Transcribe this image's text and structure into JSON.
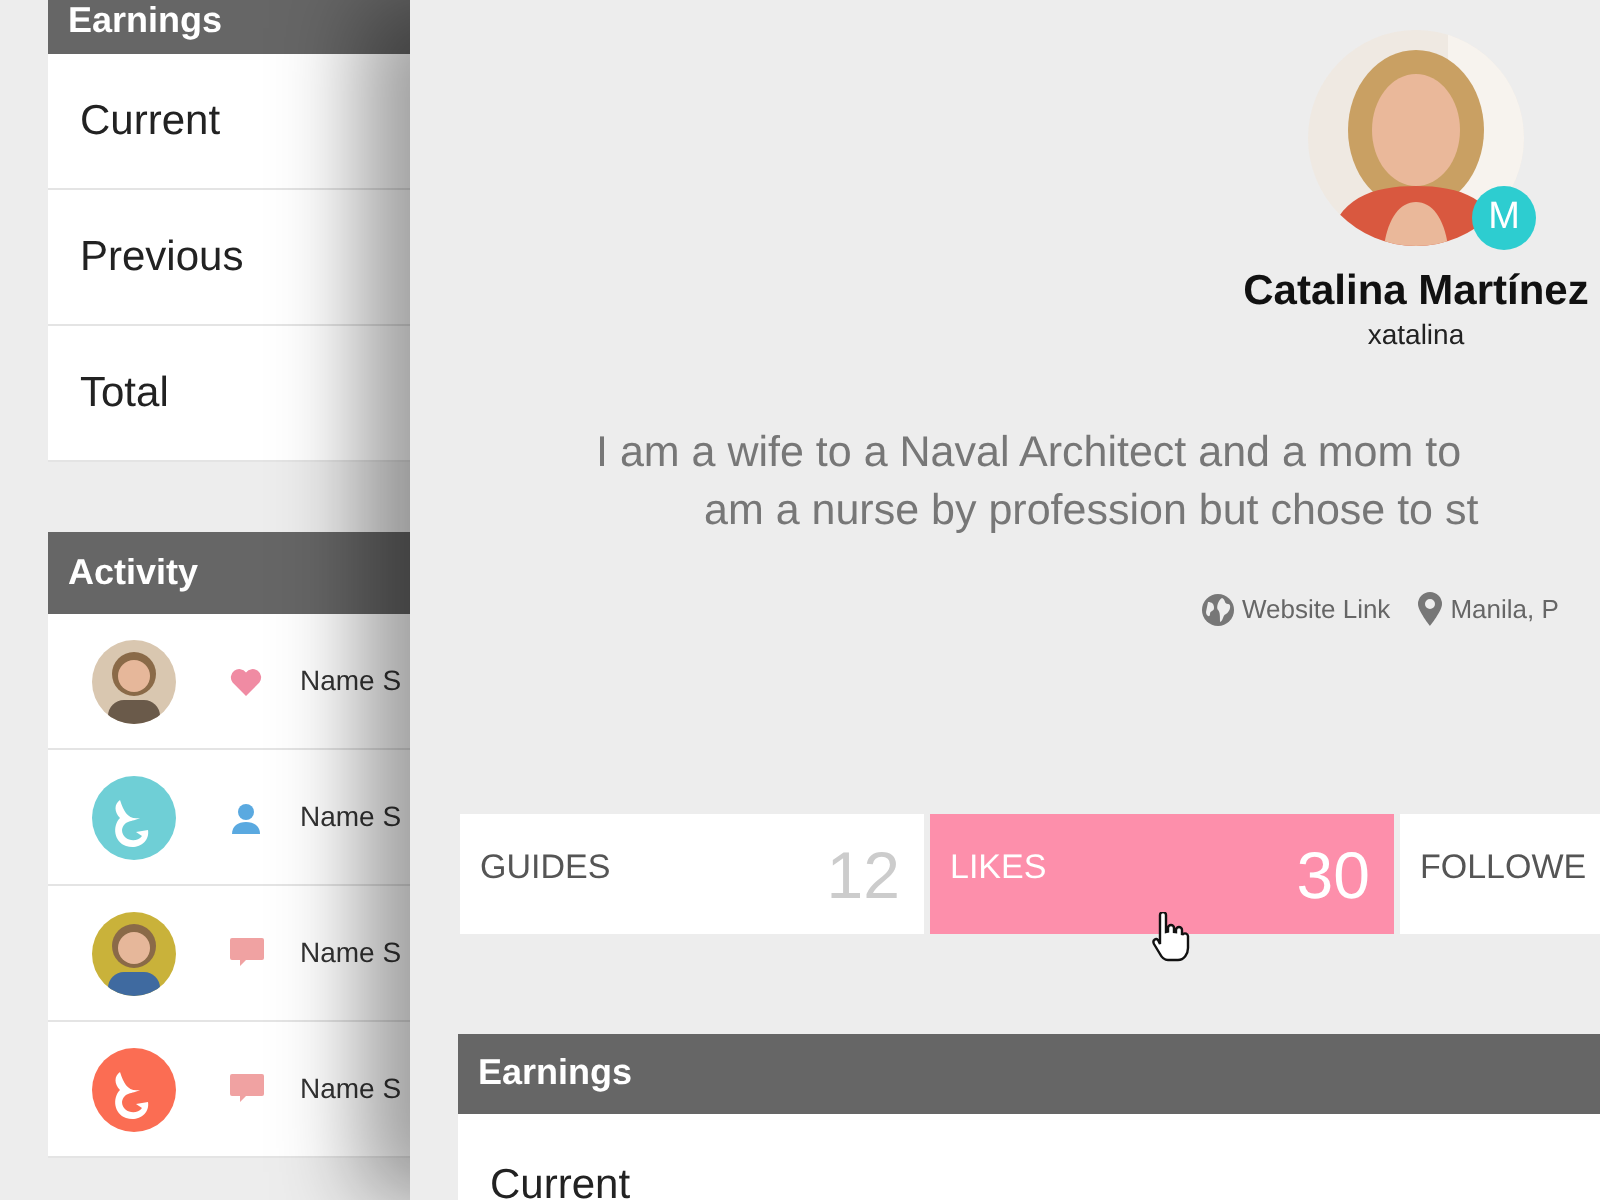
{
  "sidebar": {
    "earnings": {
      "title": "Earnings",
      "items": [
        "Current",
        "Previous",
        "Total"
      ]
    },
    "activity": {
      "title": "Activity",
      "rows": [
        {
          "kind": "like",
          "name": "Name S"
        },
        {
          "avatar": {
            "kind": "logo",
            "color": "#6fcfd6"
          },
          "kind": "follow",
          "name": "Name S"
        },
        {
          "kind": "comment",
          "name": "Name S"
        },
        {
          "avatar": {
            "kind": "logo",
            "color": "#fb6d53"
          },
          "kind": "comment",
          "name": "Name S"
        }
      ]
    }
  },
  "profile": {
    "badge": "M",
    "name": "Catalina Martínez",
    "username": "xatalina",
    "bio": [
      "I am a wife to a Naval Architect and a mom to",
      "am a nurse by profession but chose to st"
    ],
    "links": [
      {
        "kind": "website",
        "label": "Website Link"
      },
      {
        "kind": "location",
        "label": "Manila, P"
      }
    ]
  },
  "tabs": [
    {
      "label": "GUIDES",
      "count": "12",
      "selected": false
    },
    {
      "label": "LIKES",
      "count": "30",
      "selected": true
    },
    {
      "label": "FOLLOWE",
      "selected": false
    }
  ],
  "earnings": {
    "title": "Earnings",
    "items": [
      "Current"
    ]
  }
}
